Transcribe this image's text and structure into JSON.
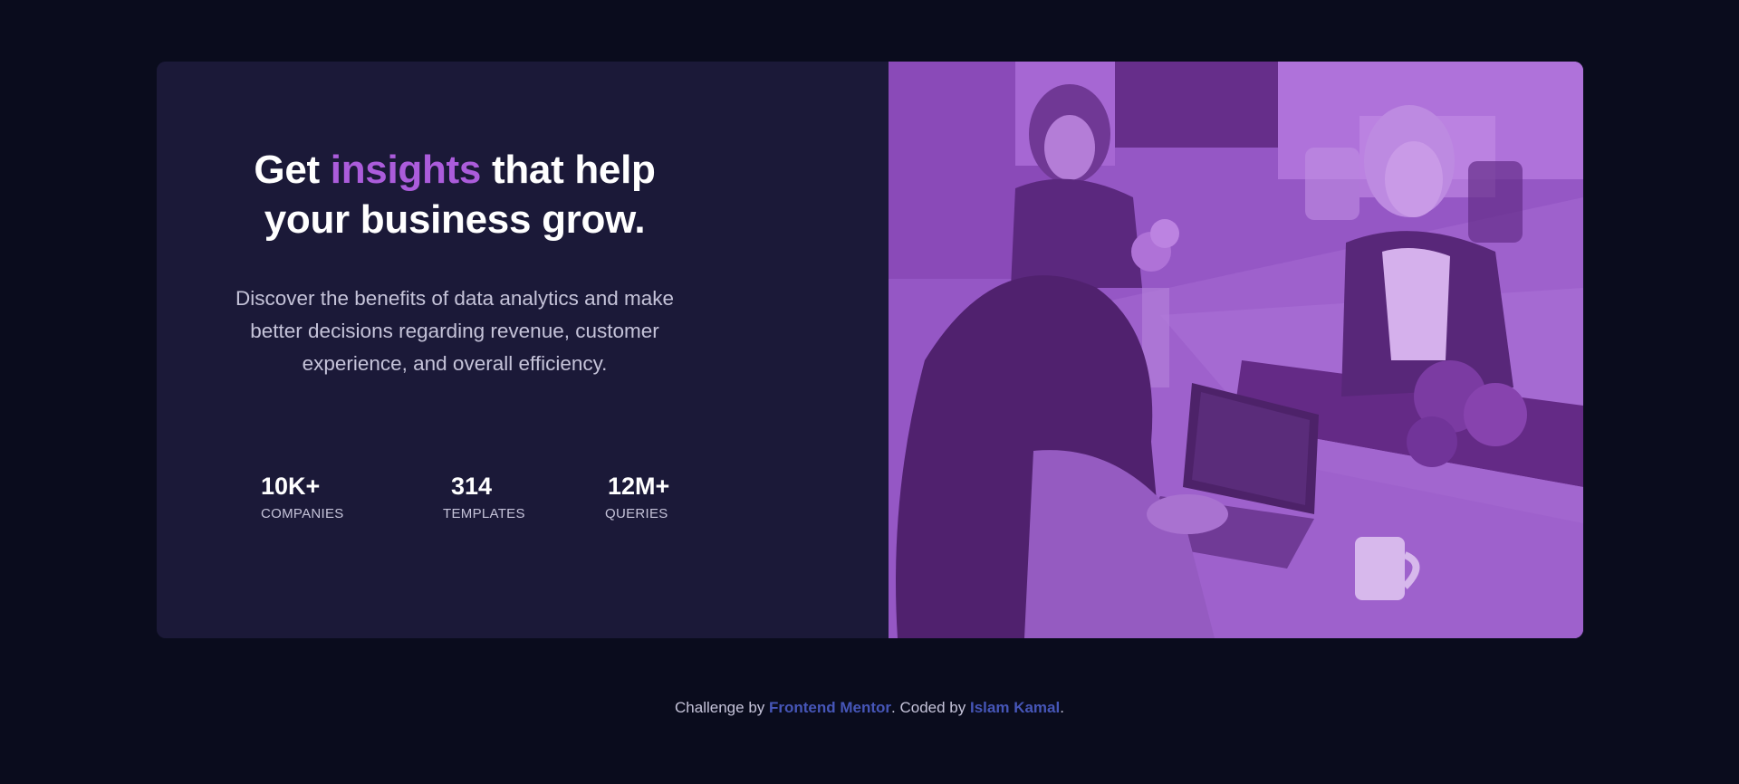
{
  "hero": {
    "heading_prefix": "Get ",
    "heading_accent": "insights",
    "heading_suffix": " that help your business grow.",
    "description": "Discover the benefits of data analytics and make better decisions regarding revenue, customer experience, and overall efficiency."
  },
  "stats": [
    {
      "value": "10K+",
      "label": "COMPANIES"
    },
    {
      "value": "314",
      "label": "TEMPLATES"
    },
    {
      "value": "12M+",
      "label": "QUERIES"
    }
  ],
  "footer": {
    "prefix": "Challenge by ",
    "challenge_link": "Frontend Mentor",
    "middle": ". Coded by ",
    "author_link": "Islam Kamal",
    "suffix": "."
  },
  "colors": {
    "background": "#0a0c1d",
    "card": "#1b1938",
    "accent": "#ab5cdb",
    "photo_overlay": "#8d4fb8",
    "link": "#4656b8",
    "muted_text": "#c5c3d9"
  },
  "image": {
    "semantic": "office-team-photo-purple-overlay"
  }
}
